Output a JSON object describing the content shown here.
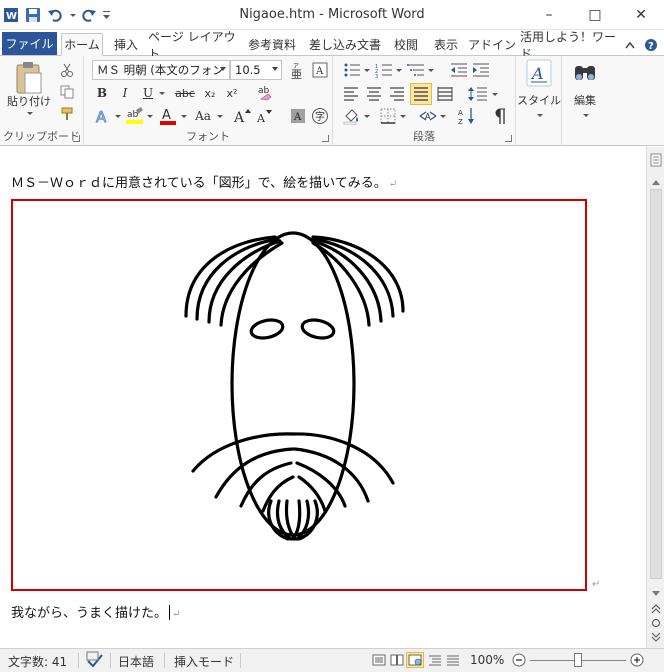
{
  "window": {
    "title": "Nigaoe.htm - Microsoft Word",
    "minimize": "–",
    "maximize": "□",
    "close": "✕"
  },
  "tabs": {
    "file": "ファイル",
    "items": [
      "ホーム",
      "挿入",
      "ページ レイアウト",
      "参考資料",
      "差し込み文書",
      "校閲",
      "表示",
      "アドイン",
      "活用しよう！ワード"
    ],
    "active": "ホーム"
  },
  "ribbon": {
    "clipboard": {
      "label": "クリップボード",
      "paste": "貼り付け"
    },
    "font": {
      "label": "フォント",
      "font_name": "ＭＳ 明朝 (本文のフォン",
      "font_size": "10.5",
      "bold": "B",
      "italic": "I",
      "underline": "U",
      "strike": "abc",
      "subscript": "x₂",
      "superscript": "x²",
      "grow": "A",
      "shrink": "A",
      "case": "Aa",
      "highlight": "ab"
    },
    "paragraph": {
      "label": "段落"
    },
    "styles": {
      "label": "スタイル"
    },
    "editing": {
      "label": "編集"
    }
  },
  "document": {
    "line1": "ＭＳ－Ｗｏｒｄに用意されている「図形」で、絵を描いてみる。",
    "line2": "我ながら、うまく描けた。",
    "pilcrow": "↵"
  },
  "status": {
    "word_count": "文字数: 41",
    "language": "日本語",
    "mode": "挿入モード",
    "zoom": "100%"
  },
  "colors": {
    "file_tab": "#2b579a",
    "frame_border": "#d00000",
    "ribbon_bg": "#f8f8f8"
  }
}
